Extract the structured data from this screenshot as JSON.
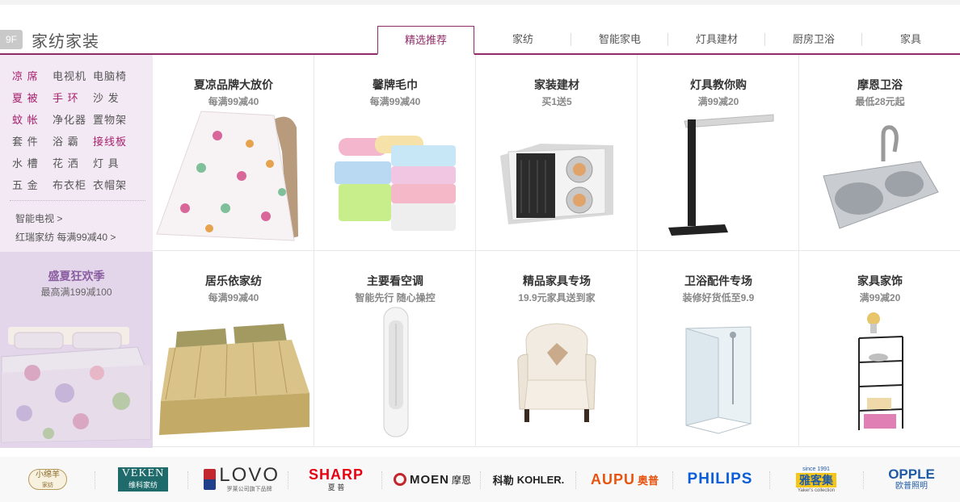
{
  "floor": {
    "badge": "9F",
    "title": "家纺家装"
  },
  "tabs": [
    {
      "label": "精选推荐",
      "active": true
    },
    {
      "label": "家纺"
    },
    {
      "label": "智能家电"
    },
    {
      "label": "灯具建材"
    },
    {
      "label": "厨房卫浴"
    },
    {
      "label": "家具"
    }
  ],
  "left_panel": {
    "categories": [
      [
        "凉",
        "席",
        "电视机",
        "电脑椅"
      ],
      [
        "夏",
        "被",
        "手",
        "环",
        "沙",
        "发"
      ],
      [
        "蚊",
        "帐",
        "净化器",
        "置物架"
      ],
      [
        "套",
        "件",
        "浴",
        "霸",
        "接线板"
      ],
      [
        "水",
        "槽",
        "花",
        "洒",
        "灯",
        "具"
      ],
      [
        "五",
        "金",
        "布衣柜",
        "衣帽架"
      ]
    ],
    "row1": [
      "凉 席",
      "电视机",
      "电脑椅"
    ],
    "row2": [
      "夏 被",
      "手 环",
      "沙 发"
    ],
    "row3": [
      "蚊 帐",
      "净化器",
      "置物架"
    ],
    "row4": [
      "套 件",
      "浴 霸",
      "接线板"
    ],
    "row5": [
      "水 槽",
      "花 洒",
      "灯 具"
    ],
    "row6": [
      "五 金",
      "布衣柜",
      "衣帽架"
    ],
    "links": [
      "智能电视 >",
      "红瑞家纺 每满99减40 >"
    ],
    "promo_title": "盛夏狂欢季",
    "promo_sub": "最高满199减100"
  },
  "products": [
    {
      "title": "夏凉品牌大放价",
      "sub": "每满99减40"
    },
    {
      "title": "馨牌毛巾",
      "sub": "每满99减40"
    },
    {
      "title": "家装建材",
      "sub": "买1送5"
    },
    {
      "title": "灯具教你购",
      "sub": "满99减20"
    },
    {
      "title": "摩恩卫浴",
      "sub": "最低28元起"
    },
    {
      "title": "居乐依家纺",
      "sub": "每满99减40"
    },
    {
      "title": "主要看空调",
      "sub": "智能先行 随心操控"
    },
    {
      "title": "精品家具专场",
      "sub": "19.9元家具送到家"
    },
    {
      "title": "卫浴配件专场",
      "sub": "装修好货低至9.9"
    },
    {
      "title": "家具家饰",
      "sub": "满99减20"
    }
  ],
  "brands": [
    {
      "name": "小绵羊",
      "tag": "家纺"
    },
    {
      "name": "VEKEN",
      "cn": "维科家纺"
    },
    {
      "name": "LOVO",
      "cn": "罗莱公司旗下品牌"
    },
    {
      "name": "SHARP",
      "cn": "夏 普"
    },
    {
      "name": "MOEN",
      "cn": "摩恩"
    },
    {
      "name": "KOHLER.",
      "cn": "科勒"
    },
    {
      "name": "AUPU",
      "cn": "奥普"
    },
    {
      "name": "PHILIPS"
    },
    {
      "name": "雅客集",
      "tag": "since 1991",
      "en": "Yaker's collection"
    },
    {
      "name": "OPPLE",
      "cn": "欧普照明"
    }
  ],
  "colors": {
    "accent": "#8e2c68",
    "left_bg": "#f3e9f4",
    "promo_bg": "#e3d6ea",
    "sharp_red": "#e60012",
    "aupu_orange": "#e8540f",
    "philips_blue": "#0b5ed7"
  }
}
